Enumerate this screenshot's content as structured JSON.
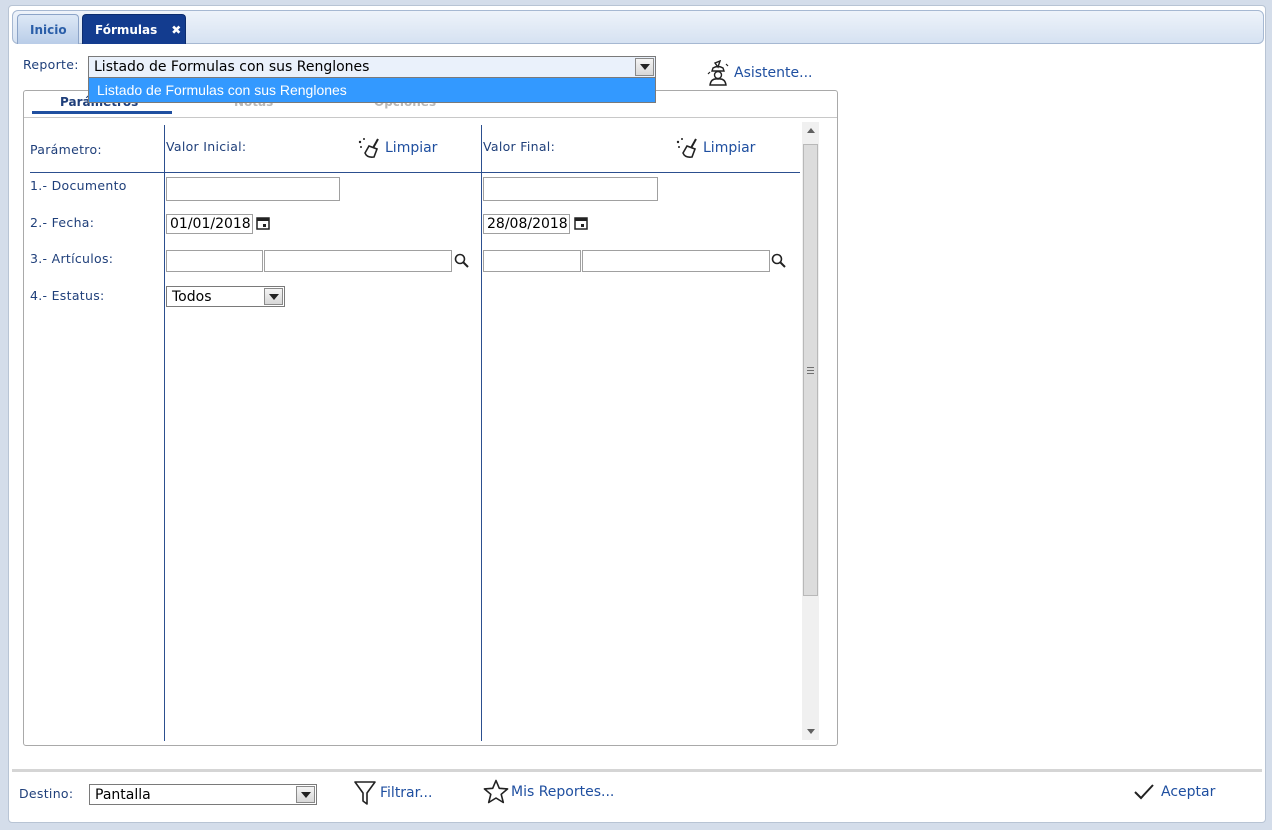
{
  "tabs": [
    {
      "label": "Inicio",
      "active": false
    },
    {
      "label": "Fórmulas",
      "active": true,
      "close": "✖"
    }
  ],
  "reporte": {
    "label": "Reporte:",
    "value": "Listado de Formulas con sus Renglones",
    "options": [
      "Listado de Formulas con sus Renglones"
    ]
  },
  "asistente_label": "Asistente...",
  "panel_tabs": [
    "Parámetros",
    "Notas",
    "Opciones"
  ],
  "columns": {
    "param": "Parámetro:",
    "initial": "Valor Inicial:",
    "final": "Valor Final:",
    "clear_label": "Limpiar"
  },
  "params": [
    {
      "label": "1.- Documento",
      "initial": "",
      "final": ""
    },
    {
      "label": "2.- Fecha:",
      "initial": "01/01/2018",
      "final": "28/08/2018"
    },
    {
      "label": "3.- Artículos:",
      "initial_code": "",
      "initial_desc": "",
      "final_code": "",
      "final_desc": ""
    },
    {
      "label": "4.- Estatus:",
      "value": "Todos"
    }
  ],
  "footer": {
    "destino_label": "Destino:",
    "destino_value": "Pantalla",
    "filtrar": "Filtrar...",
    "mis_reportes": "Mis Reportes...",
    "aceptar": "Aceptar"
  },
  "colors": {
    "accent": "#133c8f",
    "selection": "#3399ff",
    "text": "#1f3f7a"
  }
}
